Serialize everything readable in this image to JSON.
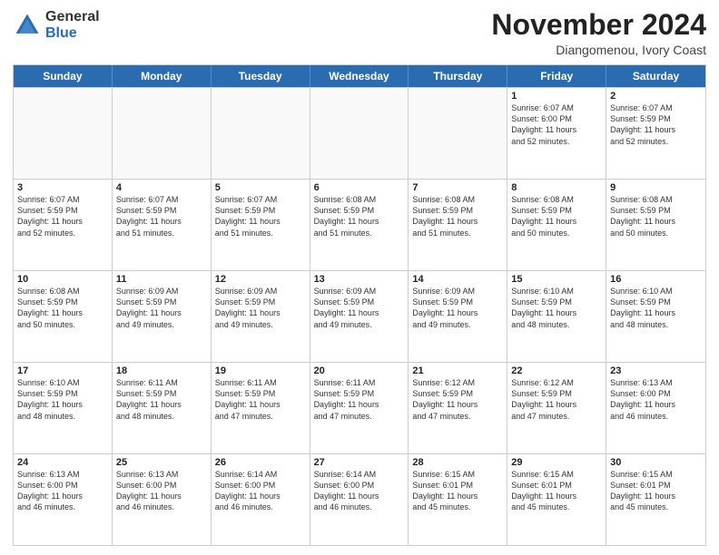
{
  "logo": {
    "general": "General",
    "blue": "Blue"
  },
  "header": {
    "month": "November 2024",
    "location": "Diangomenou, Ivory Coast"
  },
  "weekdays": [
    "Sunday",
    "Monday",
    "Tuesday",
    "Wednesday",
    "Thursday",
    "Friday",
    "Saturday"
  ],
  "weeks": [
    [
      {
        "day": "",
        "info": ""
      },
      {
        "day": "",
        "info": ""
      },
      {
        "day": "",
        "info": ""
      },
      {
        "day": "",
        "info": ""
      },
      {
        "day": "",
        "info": ""
      },
      {
        "day": "1",
        "info": "Sunrise: 6:07 AM\nSunset: 6:00 PM\nDaylight: 11 hours\nand 52 minutes."
      },
      {
        "day": "2",
        "info": "Sunrise: 6:07 AM\nSunset: 5:59 PM\nDaylight: 11 hours\nand 52 minutes."
      }
    ],
    [
      {
        "day": "3",
        "info": "Sunrise: 6:07 AM\nSunset: 5:59 PM\nDaylight: 11 hours\nand 52 minutes."
      },
      {
        "day": "4",
        "info": "Sunrise: 6:07 AM\nSunset: 5:59 PM\nDaylight: 11 hours\nand 51 minutes."
      },
      {
        "day": "5",
        "info": "Sunrise: 6:07 AM\nSunset: 5:59 PM\nDaylight: 11 hours\nand 51 minutes."
      },
      {
        "day": "6",
        "info": "Sunrise: 6:08 AM\nSunset: 5:59 PM\nDaylight: 11 hours\nand 51 minutes."
      },
      {
        "day": "7",
        "info": "Sunrise: 6:08 AM\nSunset: 5:59 PM\nDaylight: 11 hours\nand 51 minutes."
      },
      {
        "day": "8",
        "info": "Sunrise: 6:08 AM\nSunset: 5:59 PM\nDaylight: 11 hours\nand 50 minutes."
      },
      {
        "day": "9",
        "info": "Sunrise: 6:08 AM\nSunset: 5:59 PM\nDaylight: 11 hours\nand 50 minutes."
      }
    ],
    [
      {
        "day": "10",
        "info": "Sunrise: 6:08 AM\nSunset: 5:59 PM\nDaylight: 11 hours\nand 50 minutes."
      },
      {
        "day": "11",
        "info": "Sunrise: 6:09 AM\nSunset: 5:59 PM\nDaylight: 11 hours\nand 49 minutes."
      },
      {
        "day": "12",
        "info": "Sunrise: 6:09 AM\nSunset: 5:59 PM\nDaylight: 11 hours\nand 49 minutes."
      },
      {
        "day": "13",
        "info": "Sunrise: 6:09 AM\nSunset: 5:59 PM\nDaylight: 11 hours\nand 49 minutes."
      },
      {
        "day": "14",
        "info": "Sunrise: 6:09 AM\nSunset: 5:59 PM\nDaylight: 11 hours\nand 49 minutes."
      },
      {
        "day": "15",
        "info": "Sunrise: 6:10 AM\nSunset: 5:59 PM\nDaylight: 11 hours\nand 48 minutes."
      },
      {
        "day": "16",
        "info": "Sunrise: 6:10 AM\nSunset: 5:59 PM\nDaylight: 11 hours\nand 48 minutes."
      }
    ],
    [
      {
        "day": "17",
        "info": "Sunrise: 6:10 AM\nSunset: 5:59 PM\nDaylight: 11 hours\nand 48 minutes."
      },
      {
        "day": "18",
        "info": "Sunrise: 6:11 AM\nSunset: 5:59 PM\nDaylight: 11 hours\nand 48 minutes."
      },
      {
        "day": "19",
        "info": "Sunrise: 6:11 AM\nSunset: 5:59 PM\nDaylight: 11 hours\nand 47 minutes."
      },
      {
        "day": "20",
        "info": "Sunrise: 6:11 AM\nSunset: 5:59 PM\nDaylight: 11 hours\nand 47 minutes."
      },
      {
        "day": "21",
        "info": "Sunrise: 6:12 AM\nSunset: 5:59 PM\nDaylight: 11 hours\nand 47 minutes."
      },
      {
        "day": "22",
        "info": "Sunrise: 6:12 AM\nSunset: 5:59 PM\nDaylight: 11 hours\nand 47 minutes."
      },
      {
        "day": "23",
        "info": "Sunrise: 6:13 AM\nSunset: 6:00 PM\nDaylight: 11 hours\nand 46 minutes."
      }
    ],
    [
      {
        "day": "24",
        "info": "Sunrise: 6:13 AM\nSunset: 6:00 PM\nDaylight: 11 hours\nand 46 minutes."
      },
      {
        "day": "25",
        "info": "Sunrise: 6:13 AM\nSunset: 6:00 PM\nDaylight: 11 hours\nand 46 minutes."
      },
      {
        "day": "26",
        "info": "Sunrise: 6:14 AM\nSunset: 6:00 PM\nDaylight: 11 hours\nand 46 minutes."
      },
      {
        "day": "27",
        "info": "Sunrise: 6:14 AM\nSunset: 6:00 PM\nDaylight: 11 hours\nand 46 minutes."
      },
      {
        "day": "28",
        "info": "Sunrise: 6:15 AM\nSunset: 6:01 PM\nDaylight: 11 hours\nand 45 minutes."
      },
      {
        "day": "29",
        "info": "Sunrise: 6:15 AM\nSunset: 6:01 PM\nDaylight: 11 hours\nand 45 minutes."
      },
      {
        "day": "30",
        "info": "Sunrise: 6:15 AM\nSunset: 6:01 PM\nDaylight: 11 hours\nand 45 minutes."
      }
    ]
  ]
}
